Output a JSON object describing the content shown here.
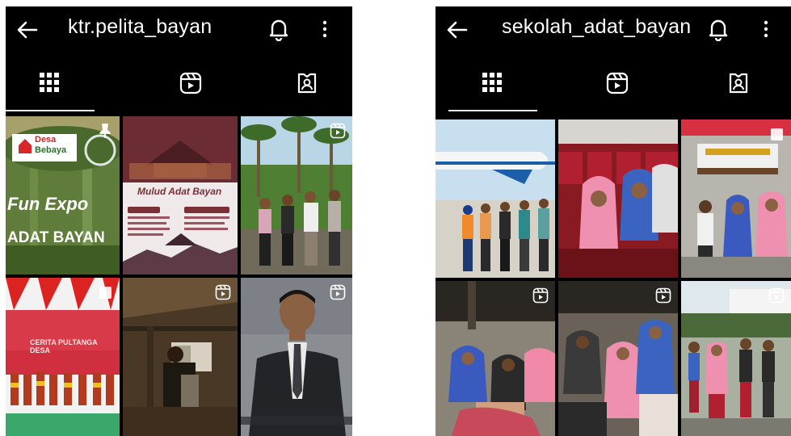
{
  "profiles": [
    {
      "username": "ktr.pelita_bayan"
    },
    {
      "username": "sekolah_adat_bayan"
    }
  ],
  "posts_left": {
    "p1_lines": [
      "Desa",
      "Bebaya",
      "Fun Expo",
      "ADAT BAYAN"
    ],
    "p2_title": "Mulud Adat Bayan",
    "p3_caption": "CERITA PULTANGA DESA"
  },
  "icons": [
    "back-arrow-icon",
    "bell-icon",
    "more-vert-icon",
    "grid-icon",
    "reels-icon",
    "tagged-icon",
    "pin-icon",
    "reel-icon",
    "multi-photo-icon"
  ],
  "colors": {
    "background": "#000000",
    "text": "#ffffff"
  }
}
